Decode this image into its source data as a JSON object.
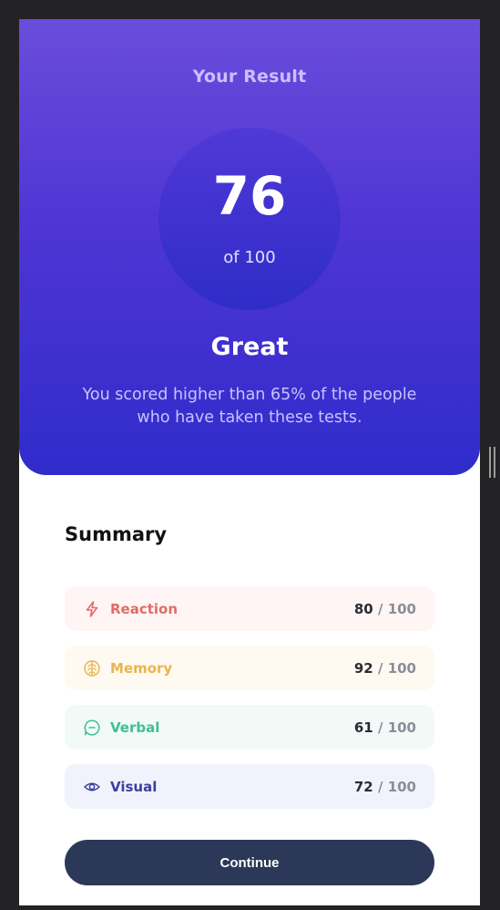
{
  "result": {
    "title": "Your Result",
    "score": "76",
    "of_label": "of 100",
    "grade": "Great",
    "description": "You scored higher than 65% of the people who have taken these tests."
  },
  "summary": {
    "title": "Summary",
    "items": [
      {
        "label": "Reaction",
        "score": "80",
        "separator": "/",
        "max": "100",
        "icon": "lightning-icon",
        "color": "#e06b6b",
        "bg": "#fff5f4"
      },
      {
        "label": "Memory",
        "score": "92",
        "separator": "/",
        "max": "100",
        "icon": "brain-icon",
        "color": "#e8b54d",
        "bg": "#fffaf1"
      },
      {
        "label": "Verbal",
        "score": "61",
        "separator": "/",
        "max": "100",
        "icon": "chat-bubble-icon",
        "color": "#3fbf94",
        "bg": "#f2faf8"
      },
      {
        "label": "Visual",
        "score": "72",
        "separator": "/",
        "max": "100",
        "icon": "eye-icon",
        "color": "#3b3f9e",
        "bg": "#f1f3fc"
      }
    ]
  },
  "continue_button": {
    "label": "Continue",
    "color": "#2c3858"
  },
  "colors": {
    "gradient_top": "#6a4ddb",
    "gradient_bottom": "#2f2ccb",
    "background": "#232325"
  }
}
